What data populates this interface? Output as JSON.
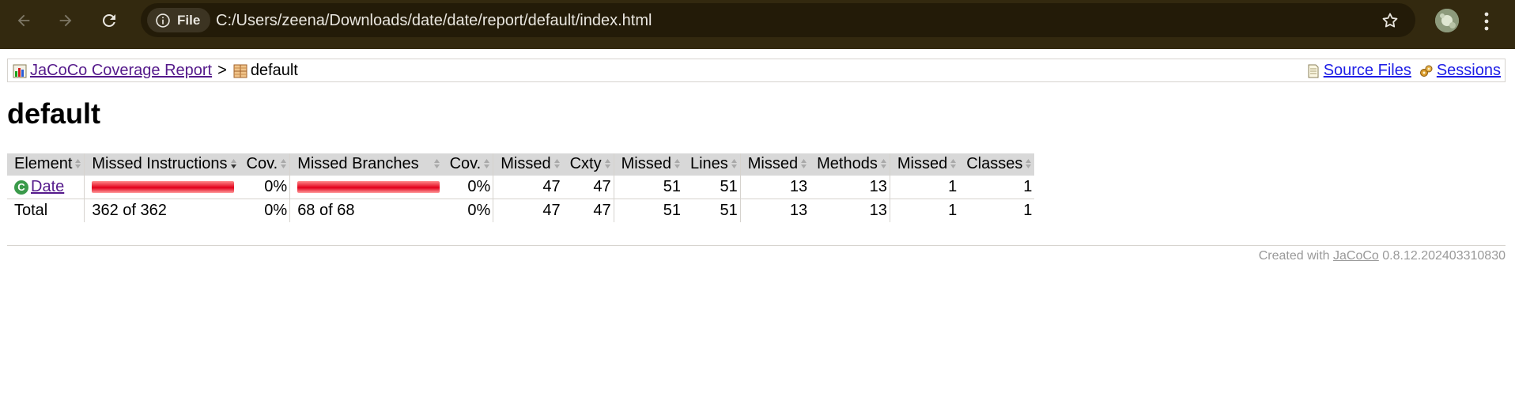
{
  "browser": {
    "site_chip_label": "File",
    "url": "C:/Users/zeena/Downloads/date/date/report/default/index.html"
  },
  "breadcrumb": {
    "root_label": "JaCoCo Coverage Report",
    "separator": ">",
    "current_label": "default",
    "source_files_label": "Source Files",
    "sessions_label": "Sessions"
  },
  "page_title": "default",
  "table": {
    "headers": [
      "Element",
      "Missed Instructions",
      "Cov.",
      "Missed Branches",
      "Cov.",
      "Missed",
      "Cxty",
      "Missed",
      "Lines",
      "Missed",
      "Methods",
      "Missed",
      "Classes"
    ],
    "rows": [
      {
        "element": "Date",
        "missed_instructions_ratio": 1.0,
        "instr_cov": "0%",
        "missed_branches_ratio": 1.0,
        "branch_cov": "0%",
        "missed_cxty": "47",
        "cxty": "47",
        "missed_lines": "51",
        "lines": "51",
        "missed_methods": "13",
        "methods": "13",
        "missed_classes": "1",
        "classes": "1"
      }
    ],
    "total": {
      "label": "Total",
      "instructions": "362 of 362",
      "instr_cov": "0%",
      "branches": "68 of 68",
      "branch_cov": "0%",
      "missed_cxty": "47",
      "cxty": "47",
      "missed_lines": "51",
      "lines": "51",
      "missed_methods": "13",
      "methods": "13",
      "missed_classes": "1",
      "classes": "1"
    }
  },
  "footer": {
    "prefix": "Created with",
    "link": "JaCoCo",
    "version": "0.8.12.202403310830"
  }
}
